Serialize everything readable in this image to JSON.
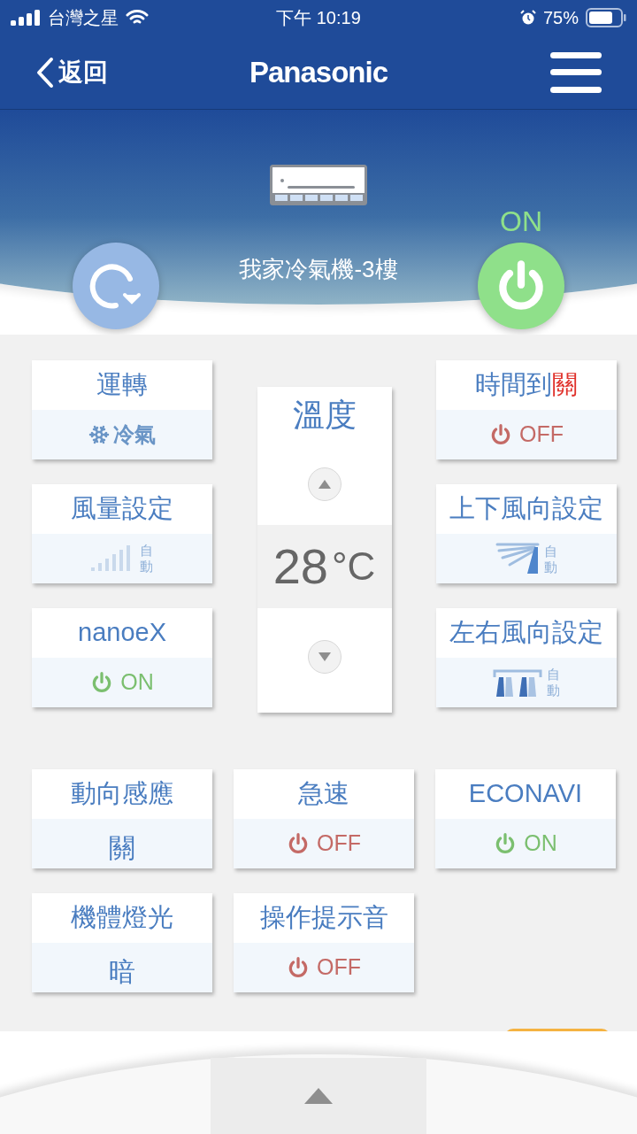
{
  "status_bar": {
    "carrier": "台灣之星",
    "time": "下午 10:19",
    "battery": "75%"
  },
  "nav": {
    "back": "返回",
    "brand": "Panasonic"
  },
  "device": {
    "name": "我家冷氣機-3樓",
    "power_label": "ON",
    "on": true
  },
  "temperature": {
    "title": "溫度",
    "value": "28",
    "unit": "°C"
  },
  "left_tiles": [
    {
      "kind": "mode",
      "title": "運轉",
      "value": "冷氣"
    },
    {
      "kind": "fan",
      "title": "風量設定",
      "value": "自動"
    },
    {
      "kind": "power",
      "title": "nanoeX",
      "value": "ON",
      "on": true
    }
  ],
  "right_tiles": [
    {
      "kind": "power",
      "title": "時間到",
      "title_accent": "關",
      "value": "OFF",
      "on": false
    },
    {
      "kind": "vane_v",
      "title": "上下風向設定",
      "value": "自動"
    },
    {
      "kind": "vane_h",
      "title": "左右風向設定",
      "value": "自動"
    }
  ],
  "grid_tiles": [
    {
      "kind": "text",
      "title": "動向感應",
      "value": "關"
    },
    {
      "kind": "power",
      "title": "急速",
      "value": "OFF",
      "on": false
    },
    {
      "kind": "power",
      "title": "ECONAVI",
      "value": "ON",
      "on": true
    },
    {
      "kind": "text",
      "title": "機體燈光",
      "value": "暗"
    },
    {
      "kind": "power",
      "title": "操作提示音",
      "value": "OFF",
      "on": false
    }
  ]
}
